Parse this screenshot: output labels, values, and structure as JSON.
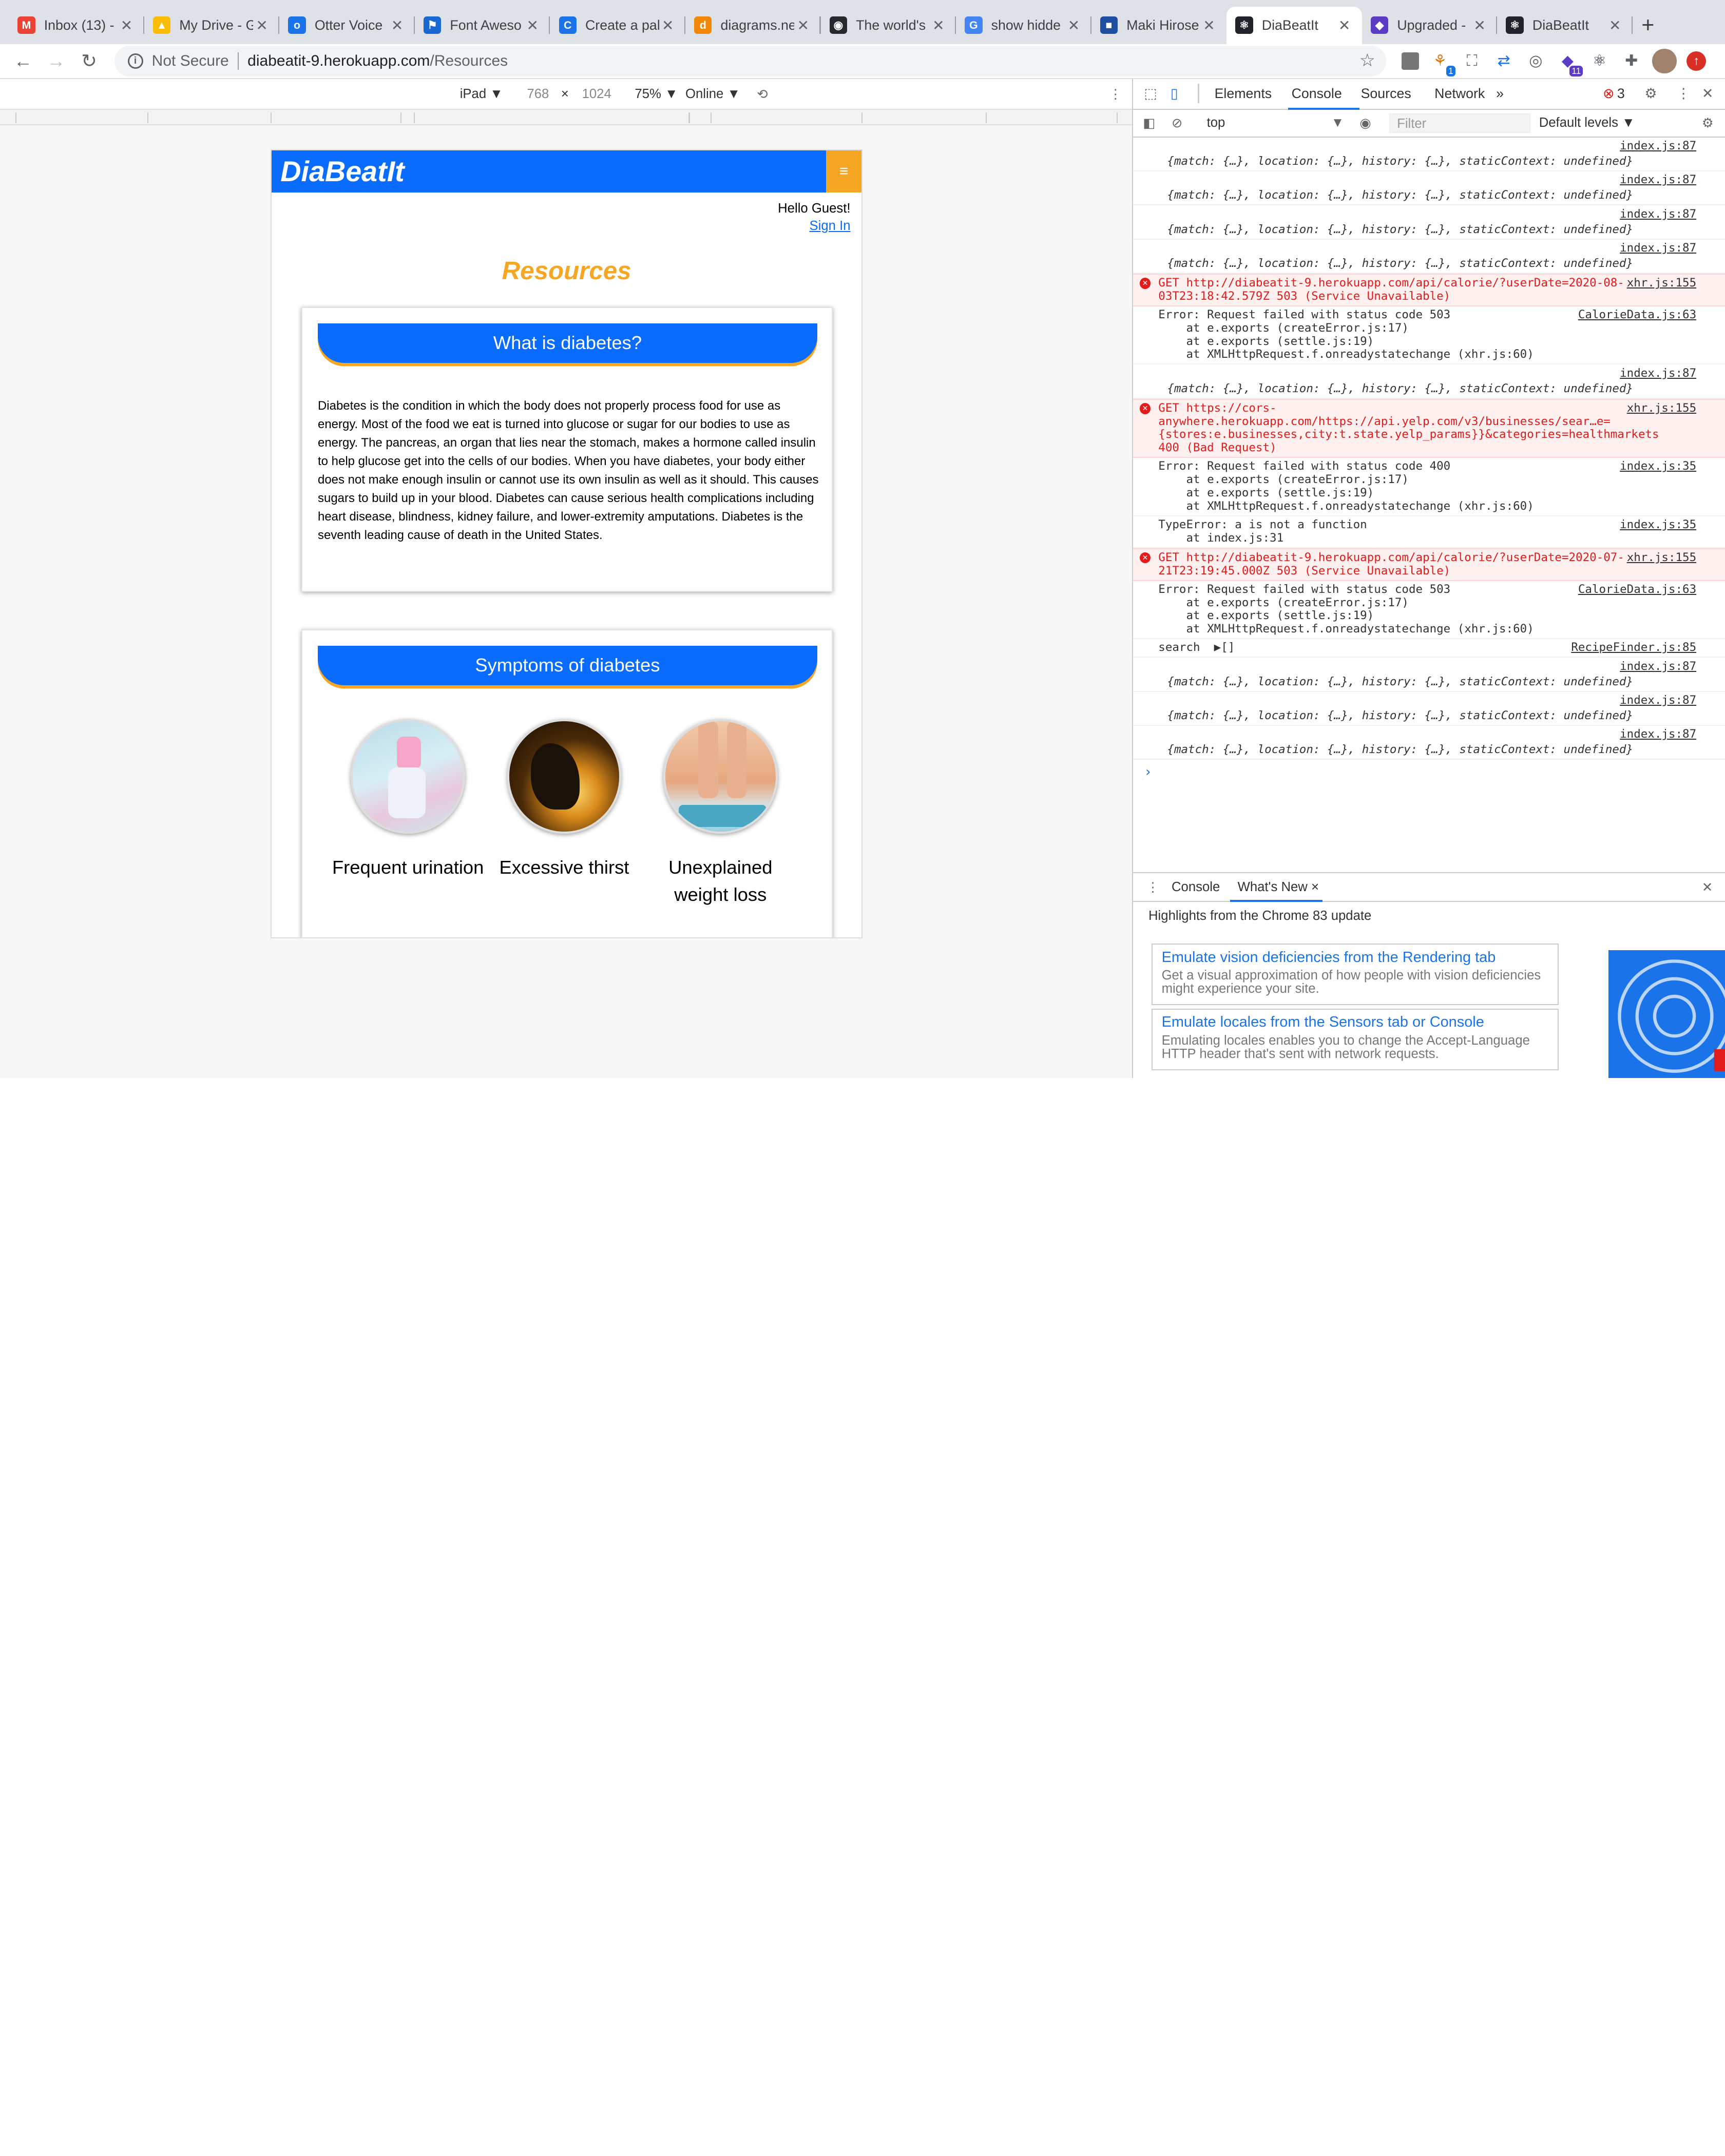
{
  "browser": {
    "tabs": [
      {
        "title": "Inbox (13) -",
        "fav": "M",
        "color": "#ea4335"
      },
      {
        "title": "My Drive - G",
        "fav": "▲",
        "color": "#fbbc04"
      },
      {
        "title": "Otter Voice",
        "fav": "o",
        "color": "#1a73e8"
      },
      {
        "title": "Font Aweso",
        "fav": "⚑",
        "color": "#1967d2"
      },
      {
        "title": "Create a pal",
        "fav": "C",
        "color": "#1a73e8"
      },
      {
        "title": "diagrams.ne",
        "fav": "d",
        "color": "#f08705"
      },
      {
        "title": "The world's",
        "fav": "◉",
        "color": "#24292e"
      },
      {
        "title": "show hidde",
        "fav": "G",
        "color": "#4285f4"
      },
      {
        "title": "Maki Hirose",
        "fav": "■",
        "color": "#1e4ea1"
      },
      {
        "title": "DiaBeatIt",
        "fav": "⚛",
        "color": "#20232a"
      },
      {
        "title": "Upgraded -",
        "fav": "◆",
        "color": "#5b3cc4"
      },
      {
        "title": "DiaBeatIt",
        "fav": "⚛",
        "color": "#20232a"
      }
    ],
    "active_tab_index": 9,
    "url_security": "Not Secure",
    "url_host": "diabeatit-9.herokuapp.com",
    "url_path": "/Resources",
    "extension_badges": {
      "one": "1",
      "eleven": "11"
    }
  },
  "device_toolbar": {
    "device": "iPad ▼",
    "width": "768",
    "times": "×",
    "height": "1024",
    "zoom": "75% ▼",
    "network": "Online ▼"
  },
  "app": {
    "logo": "DiaBeatIt",
    "menu_icon": "≡",
    "greeting": "Hello Guest!",
    "sign_in": "Sign In",
    "page_title": "Resources",
    "card1": {
      "heading": "What is diabetes?",
      "body": "Diabetes is the condition in which the body does not properly process food for use as energy. Most of the food we eat is turned into glucose or sugar for our bodies to use as energy. The pancreas, an organ that lies near the stomach, makes a hormone called insulin to help glucose get into the cells of our bodies. When you have diabetes, your body either does not make enough insulin or cannot use its own insulin as well as it should. This causes sugars to build up in your blood. Diabetes can cause serious health complications including heart disease, blindness, kidney failure, and lower-extremity amputations. Diabetes is the seventh leading cause of death in the United States."
    },
    "card2": {
      "heading": "Symptoms of diabetes",
      "symptoms": [
        "Frequent urination",
        "Excessive thirst",
        "Unexplained weight loss"
      ]
    }
  },
  "devtools": {
    "tabs": [
      "Elements",
      "Console",
      "Sources",
      "Network"
    ],
    "more": "»",
    "error_count": "3",
    "context": "top",
    "filter_placeholder": "Filter",
    "levels": "Default levels ▼",
    "messages": [
      {
        "kind": "props",
        "src": "index.js:87",
        "text": "{match: {…}, location: {…}, history: {…}, staticContext: undefined}"
      },
      {
        "kind": "props",
        "src": "index.js:87",
        "text": "{match: {…}, location: {…}, history: {…}, staticContext: undefined}"
      },
      {
        "kind": "props",
        "src": "index.js:87",
        "text": "{match: {…}, location: {…}, history: {…}, staticContext: undefined}"
      },
      {
        "kind": "props",
        "src": "index.js:87",
        "text": "{match: {…}, location: {…}, history: {…}, staticContext: undefined}"
      },
      {
        "kind": "err",
        "src": "xhr.js:155",
        "text": "GET http://diabeatit-9.herokuapp.com/api/calorie/?userDate=2020-08-03T23:18:42.579Z 503 (Service Unavailable)"
      },
      {
        "kind": "log",
        "src": "CalorieData.js:63",
        "text": "Error: Request failed with status code 503\n    at e.exports (createError.js:17)\n    at e.exports (settle.js:19)\n    at XMLHttpRequest.f.onreadystatechange (xhr.js:60)"
      },
      {
        "kind": "props",
        "src": "index.js:87",
        "text": "{match: {…}, location: {…}, history: {…}, staticContext: undefined}"
      },
      {
        "kind": "err",
        "src": "xhr.js:155",
        "text": "GET https://cors-anywhere.herokuapp.com/https://api.yelp.com/v3/businesses/sear…e={stores:e.businesses,city:t.state.yelp_params}}&categories=healthmarkets 400 (Bad Request)"
      },
      {
        "kind": "log",
        "src": "index.js:35",
        "text": "Error: Request failed with status code 400\n    at e.exports (createError.js:17)\n    at e.exports (settle.js:19)\n    at XMLHttpRequest.f.onreadystatechange (xhr.js:60)"
      },
      {
        "kind": "log",
        "src": "index.js:35",
        "text": "TypeError: a is not a function\n    at index.js:31"
      },
      {
        "kind": "err",
        "src": "xhr.js:155",
        "text": "GET http://diabeatit-9.herokuapp.com/api/calorie/?userDate=2020-07-21T23:19:45.000Z 503 (Service Unavailable)"
      },
      {
        "kind": "log",
        "src": "CalorieData.js:63",
        "text": "Error: Request failed with status code 503\n    at e.exports (createError.js:17)\n    at e.exports (settle.js:19)\n    at XMLHttpRequest.f.onreadystatechange (xhr.js:60)"
      },
      {
        "kind": "log",
        "src": "RecipeFinder.js:85",
        "text": "search  ▶[]"
      },
      {
        "kind": "props",
        "src": "index.js:87",
        "text": "{match: {…}, location: {…}, history: {…}, staticContext: undefined}"
      },
      {
        "kind": "props",
        "src": "index.js:87",
        "text": "{match: {…}, location: {…}, history: {…}, staticContext: undefined}"
      },
      {
        "kind": "props",
        "src": "index.js:87",
        "text": "{match: {…}, location: {…}, history: {…}, staticContext: undefined}"
      }
    ],
    "prompt": "›",
    "drawer": {
      "tabs": [
        "Console",
        "What's New ×"
      ],
      "highlights": "Highlights from the Chrome 83 update",
      "items": [
        {
          "title": "Emulate vision deficiencies from the Rendering tab",
          "desc": "Get a visual approximation of how people with vision deficiencies might experience your site."
        },
        {
          "title": "Emulate locales from the Sensors tab or Console",
          "desc": "Emulating locales enables you to change the Accept-Language HTTP header that's sent with network requests."
        }
      ]
    }
  }
}
